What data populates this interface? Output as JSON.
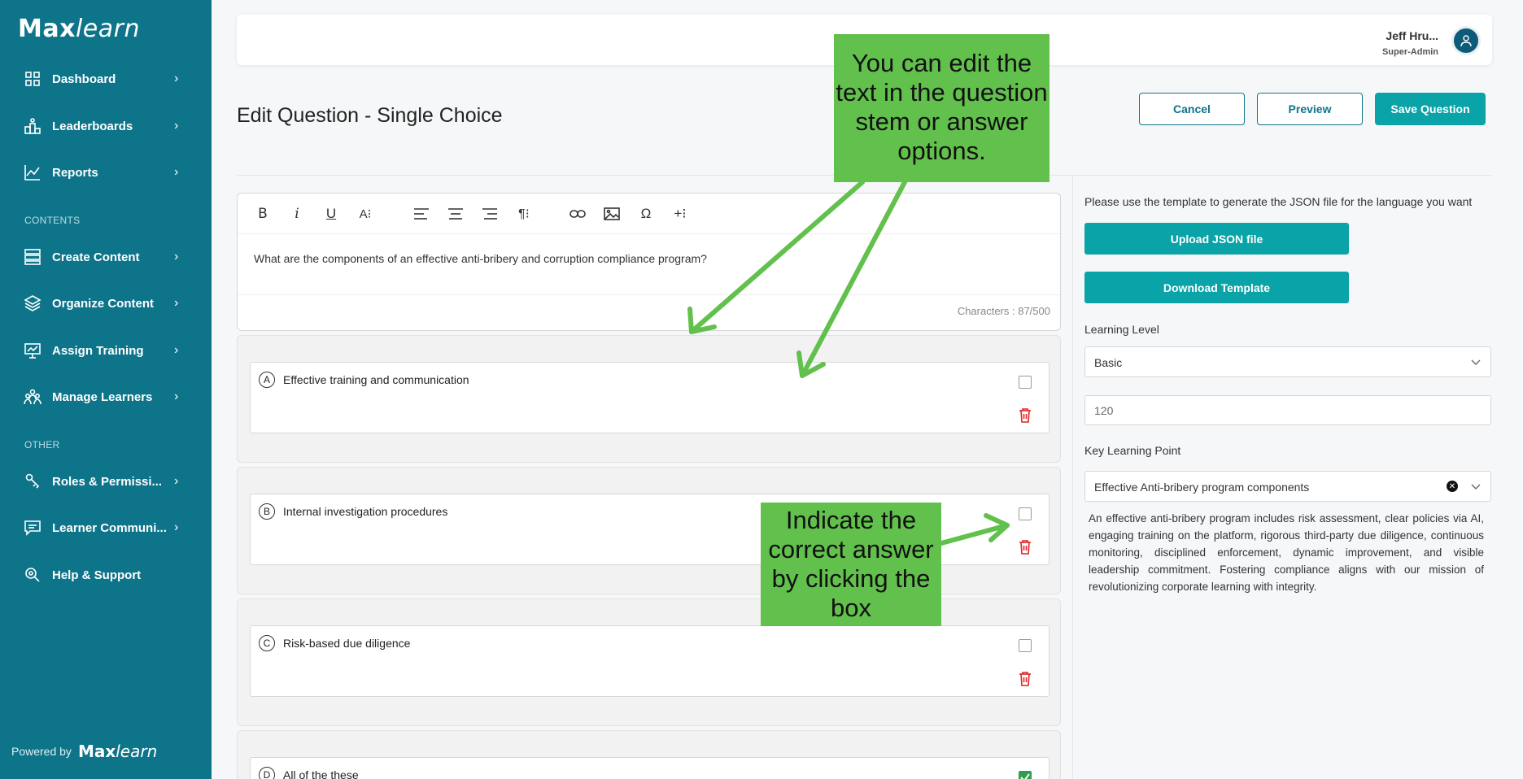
{
  "sidebar": {
    "logo_bold": "Max",
    "logo_thin": "learn",
    "items": [
      {
        "label": "Dashboard",
        "icon": "dashboard-grid-icon"
      },
      {
        "label": "Leaderboards",
        "icon": "podium-icon"
      },
      {
        "label": "Reports",
        "icon": "chart-line-icon"
      },
      {
        "label": "Create Content",
        "icon": "layers-stack-icon"
      },
      {
        "label": "Organize Content",
        "icon": "layers-icon"
      },
      {
        "label": "Assign Training",
        "icon": "presentation-board-icon"
      },
      {
        "label": "Manage Learners",
        "icon": "people-group-icon"
      },
      {
        "label": "Roles & Permissi...",
        "icon": "key-hand-icon"
      },
      {
        "label": "Learner Communi...",
        "icon": "chat-icon"
      },
      {
        "label": "Help & Support",
        "icon": "headset-icon"
      }
    ],
    "section_contents": "CONTENTS",
    "section_other": "OTHER",
    "powered_by": "Powered by"
  },
  "topbar": {
    "user_name": "Jeff Hru...",
    "user_role": "Super-Admin"
  },
  "page": {
    "title": "Edit Question - Single Choice",
    "cancel_label": "Cancel",
    "preview_label": "Preview",
    "save_label": "Save Question"
  },
  "editor": {
    "toolbar": [
      "B",
      "i",
      "U",
      "A⁝",
      "align-left",
      "align-center",
      "align-right",
      "¶⁝",
      "link",
      "image",
      "Ω",
      "+⁝"
    ],
    "stem_text": "What are the components of an effective anti-bribery and corruption compliance program?",
    "char_count": "Characters : 87/500"
  },
  "options": [
    {
      "letter": "A",
      "text": "Effective training and communication",
      "checked": false
    },
    {
      "letter": "B",
      "text": "Internal investigation procedures",
      "checked": false
    },
    {
      "letter": "C",
      "text": "Risk-based due diligence",
      "checked": false
    },
    {
      "letter": "D",
      "text": "All of the these",
      "checked": true
    }
  ],
  "right_panel": {
    "note": "Please use the template to generate the JSON file for the language you want",
    "upload_label": "Upload JSON file",
    "download_label": "Download Template",
    "learning_level_label": "Learning Level",
    "learning_level_value": "Basic",
    "time_value": "120",
    "key_learning_point_label": "Key Learning Point",
    "key_learning_point_value": "Effective Anti-bribery program components",
    "description": "An effective anti-bribery program includes risk assessment, clear policies via AI, engaging training on the platform, rigorous third-party due diligence, continuous monitoring, disciplined enforcement, dynamic improvement, and visible leadership commitment. Fostering compliance aligns with our mission of revolutionizing corporate learning with integrity."
  },
  "callouts": {
    "edit_text": "You can edit the text in the question stem or answer options.",
    "indicate_text": "Indicate the correct answer by clicking the box",
    "color": "#62c04c"
  },
  "colors": {
    "sidebar": "#0e7489",
    "primary": "#0aa3a8",
    "check": "#2e9d4f",
    "trash": "#e02424"
  }
}
